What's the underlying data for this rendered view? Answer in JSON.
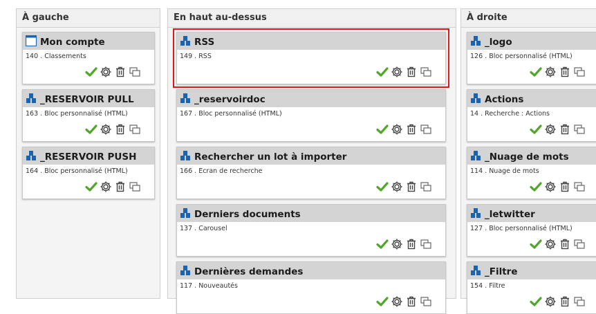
{
  "columns": [
    {
      "title": "À gauche",
      "blocks": [
        {
          "title": "Mon compte",
          "subtitle": "140 . Classements",
          "icon": "page-icon"
        },
        {
          "title": "_RESERVOIR PULL",
          "subtitle": "163 . Bloc personnalisé (HTML)",
          "icon": "blocks-icon"
        },
        {
          "title": "_RESERVOIR PUSH",
          "subtitle": "164 . Bloc personnalisé (HTML)",
          "icon": "blocks-icon"
        }
      ]
    },
    {
      "title": "En haut au-dessus",
      "blocks": [
        {
          "title": "RSS",
          "subtitle": "149 . RSS",
          "icon": "blocks-icon",
          "selected": true
        },
        {
          "title": "_reservoirdoc",
          "subtitle": "167 . Bloc personnalisé (HTML)",
          "icon": "blocks-icon"
        },
        {
          "title": "Rechercher un lot à importer",
          "subtitle": "166 . Ecran de recherche",
          "icon": "blocks-icon"
        },
        {
          "title": "Derniers documents",
          "subtitle": "137 . Carousel",
          "icon": "blocks-icon"
        },
        {
          "title": "Dernières demandes",
          "subtitle": "117 . Nouveautés",
          "icon": "blocks-icon"
        }
      ]
    },
    {
      "title": "À droite",
      "blocks": [
        {
          "title": "_logo",
          "subtitle": "126 . Bloc personnalisé (HTML)",
          "icon": "blocks-icon"
        },
        {
          "title": "Actions",
          "subtitle": "14 . Recherche : Actions",
          "icon": "blocks-icon"
        },
        {
          "title": "_Nuage de mots",
          "subtitle": "114 . Nuage de mots",
          "icon": "blocks-icon"
        },
        {
          "title": "_letwitter",
          "subtitle": "127 . Bloc personnalisé (HTML)",
          "icon": "blocks-icon"
        },
        {
          "title": "_Filtre",
          "subtitle": "154 . Filtre",
          "icon": "blocks-icon"
        }
      ]
    }
  ],
  "action_icons": [
    "check-icon",
    "gear-icon",
    "trash-icon",
    "duplicate-icon"
  ],
  "colors": {
    "check": "#52a62c",
    "selection": "#e0181c",
    "block_icon": "#1a63b0",
    "title_bar": "#d4d4d4"
  }
}
